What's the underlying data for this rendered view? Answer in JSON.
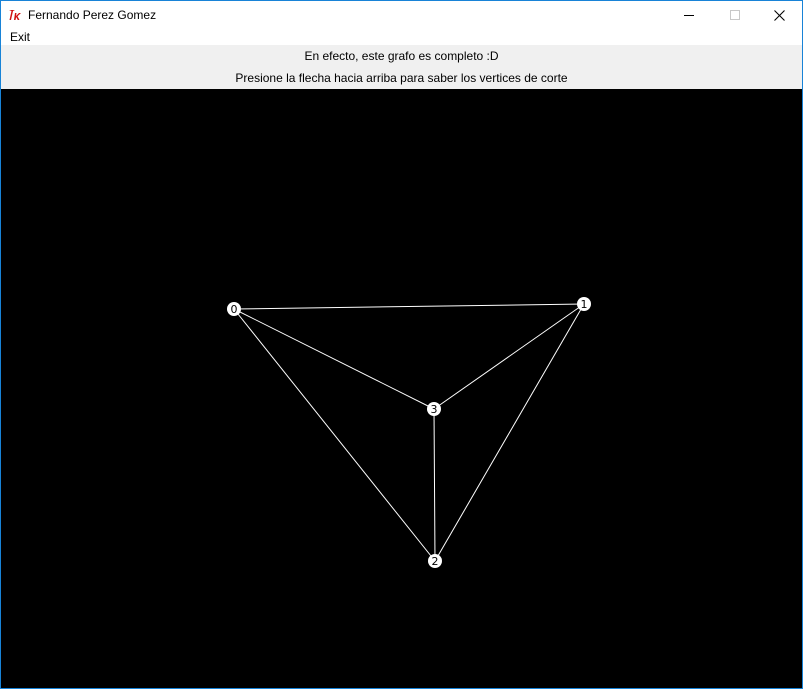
{
  "window": {
    "title": "Fernando Perez Gomez",
    "icon": "tk-feather-icon",
    "accent_color": "#1883d7"
  },
  "menubar": {
    "items": [
      {
        "label": "Exit"
      }
    ]
  },
  "labels": {
    "line1": "En efecto, este grafo es completo :D",
    "line2": "Presione la flecha hacia arriba para saber los vertices de corte"
  },
  "graph": {
    "background": "#000000",
    "edge_color": "#ffffff",
    "node_fill": "#ffffff",
    "nodes": [
      {
        "id": "0",
        "label": "0"
      },
      {
        "id": "1",
        "label": "1"
      },
      {
        "id": "2",
        "label": "2"
      },
      {
        "id": "3",
        "label": "3"
      }
    ],
    "edges": [
      [
        "0",
        "1"
      ],
      [
        "0",
        "3"
      ],
      [
        "0",
        "2"
      ],
      [
        "1",
        "3"
      ],
      [
        "1",
        "2"
      ],
      [
        "3",
        "2"
      ]
    ]
  }
}
